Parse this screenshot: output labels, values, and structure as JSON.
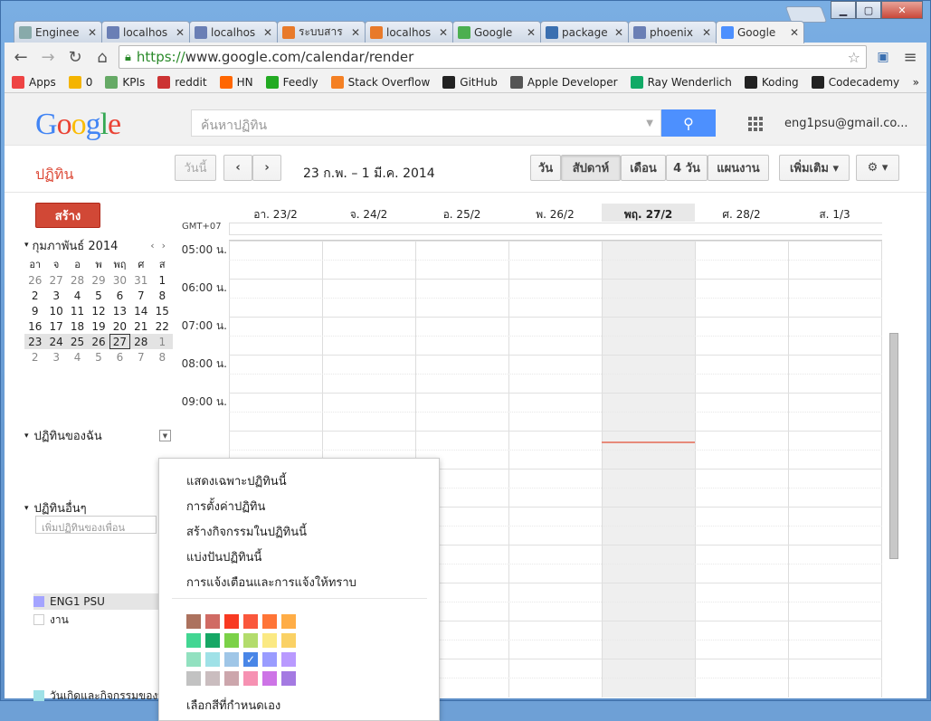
{
  "window": {
    "min": "▁",
    "max": "▢",
    "close": "✕"
  },
  "tabs": [
    {
      "title": "Enginee",
      "fav": "#8aa"
    },
    {
      "title": "localhos",
      "fav": "#6a7fb5"
    },
    {
      "title": "localhos",
      "fav": "#6a7fb5"
    },
    {
      "title": "ระบบสาร",
      "fav": "#e87a2a"
    },
    {
      "title": "localhos",
      "fav": "#e87a2a"
    },
    {
      "title": "Google",
      "fav": "#4caf50"
    },
    {
      "title": "package",
      "fav": "#3a6fb0"
    },
    {
      "title": "phoenix",
      "fav": "#6a7fb5"
    },
    {
      "title": "Google",
      "fav": "#4d90fe"
    }
  ],
  "address": {
    "https": "https://",
    "rest": "www.google.com/calendar/render"
  },
  "bookmarks": [
    "Apps",
    "0",
    "KPIs",
    "reddit",
    "HN",
    "Feedly",
    "Stack Overflow",
    "GitHub",
    "Apple Developer",
    "Ray Wenderlich",
    "Koding",
    "Codecademy"
  ],
  "header": {
    "search_placeholder": "ค้นหาปฏิทิน",
    "email": "eng1psu@gmail.co..."
  },
  "calbar": {
    "app": "ปฏิทิน",
    "today": "วันนี้",
    "range": "23 ก.พ. – 1 มี.ค. 2014",
    "views": [
      "วัน",
      "สัปดาห์",
      "เดือน",
      "4 วัน",
      "แผนงาน"
    ],
    "more": "เพิ่มเติม ▾",
    "gear": "⚙ ▾"
  },
  "create": "สร้าง",
  "mini": {
    "title": "กุมภาพันธ์ 2014",
    "days": [
      "อา",
      "จ",
      "อ",
      "พ",
      "พฤ",
      "ศ",
      "ส"
    ],
    "weeks": [
      [
        "26",
        "27",
        "28",
        "29",
        "30",
        "31",
        "1"
      ],
      [
        "2",
        "3",
        "4",
        "5",
        "6",
        "7",
        "8"
      ],
      [
        "9",
        "10",
        "11",
        "12",
        "13",
        "14",
        "15"
      ],
      [
        "16",
        "17",
        "18",
        "19",
        "20",
        "21",
        "22"
      ],
      [
        "23",
        "24",
        "25",
        "26",
        "27",
        "28",
        "1"
      ],
      [
        "2",
        "3",
        "4",
        "5",
        "6",
        "7",
        "8"
      ]
    ]
  },
  "my_cals": {
    "title": "ปฏิทินของฉัน",
    "items": [
      {
        "name": "ENG1 PSU",
        "color": "#a4a4ff"
      },
      {
        "name": "งาน",
        "color": "#ffffff"
      }
    ]
  },
  "other_cals": {
    "title": "ปฏิทินอื่นๆ",
    "placeholder": "เพิ่มปฏิทินของเพื่อน",
    "items": [
      {
        "name": "วันเกิดและกิจกรรมของที่",
        "color": "#9fe1e7"
      }
    ]
  },
  "week": {
    "gmt": "GMT+07",
    "days": [
      "อา. 23/2",
      "จ. 24/2",
      "อ. 25/2",
      "พ. 26/2",
      "พฤ. 27/2",
      "ศ. 28/2",
      "ส. 1/3"
    ],
    "times": [
      "05:00 น.",
      "06:00 น.",
      "07:00 น.",
      "08:00 น.",
      "09:00 น."
    ]
  },
  "menu": {
    "items": [
      "แสดงเฉพาะปฏิทินนี้",
      "การตั้งค่าปฏิทิน",
      "สร้างกิจกรรมในปฏิทินนี้",
      "แบ่งปันปฏิทินนี้",
      "การแจ้งเตือนและการแจ้งให้ทราบ"
    ],
    "custom": "เลือกสีที่กำหนดเอง",
    "colors": [
      "#ac725e",
      "#d06b64",
      "#f83a22",
      "#fa573c",
      "#ff7537",
      "#ffad46",
      "#42d692",
      "#16a765",
      "#7bd148",
      "#b3dc6c",
      "#fbe983",
      "#fad165",
      "#92e1c0",
      "#9fe1e7",
      "#9fc6e7",
      "#4986e7",
      "#9a9cff",
      "#b99aff",
      "#c2c2c2",
      "#cabdbf",
      "#cca6ac",
      "#f691b2",
      "#cd74e6",
      "#a47ae2"
    ]
  }
}
